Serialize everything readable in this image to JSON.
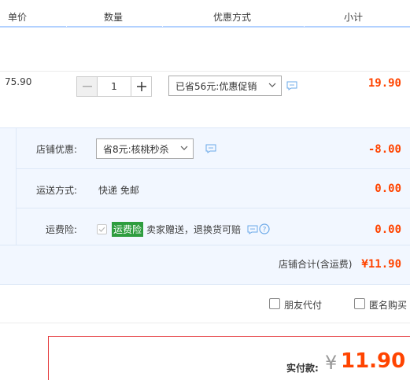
{
  "header": {
    "unit_price": "单价",
    "quantity": "数量",
    "promo_method": "优惠方式",
    "subtotal": "小计"
  },
  "item": {
    "unit_price": "75.90",
    "quantity": "1",
    "promo_select": "已省56元:优惠促销",
    "subtotal": "19.90"
  },
  "shop": {
    "promo_label": "店铺优惠:",
    "promo_select": "省8元:核桃秒杀",
    "promo_value": "-8.00",
    "shipping_label": "运送方式:",
    "shipping_value": "快递 免邮",
    "shipping_cost": "0.00",
    "insurance_label": "运费险:",
    "insurance_tag": "运费险",
    "insurance_text": "卖家赠送，退换货可赔",
    "insurance_cost": "0.00",
    "total_label": "店铺合计(含运费)",
    "total_value": "¥11.90"
  },
  "options": {
    "friend_pay": "朋友代付",
    "anonymous": "匿名购买"
  },
  "payment": {
    "label": "实付款:",
    "currency": "¥",
    "amount": "11.90"
  },
  "colors": {
    "accent": "#ff4400",
    "header_line": "#b2d1ff",
    "block_bg": "#f2f7ff",
    "tag_green": "#2e9d3f"
  }
}
